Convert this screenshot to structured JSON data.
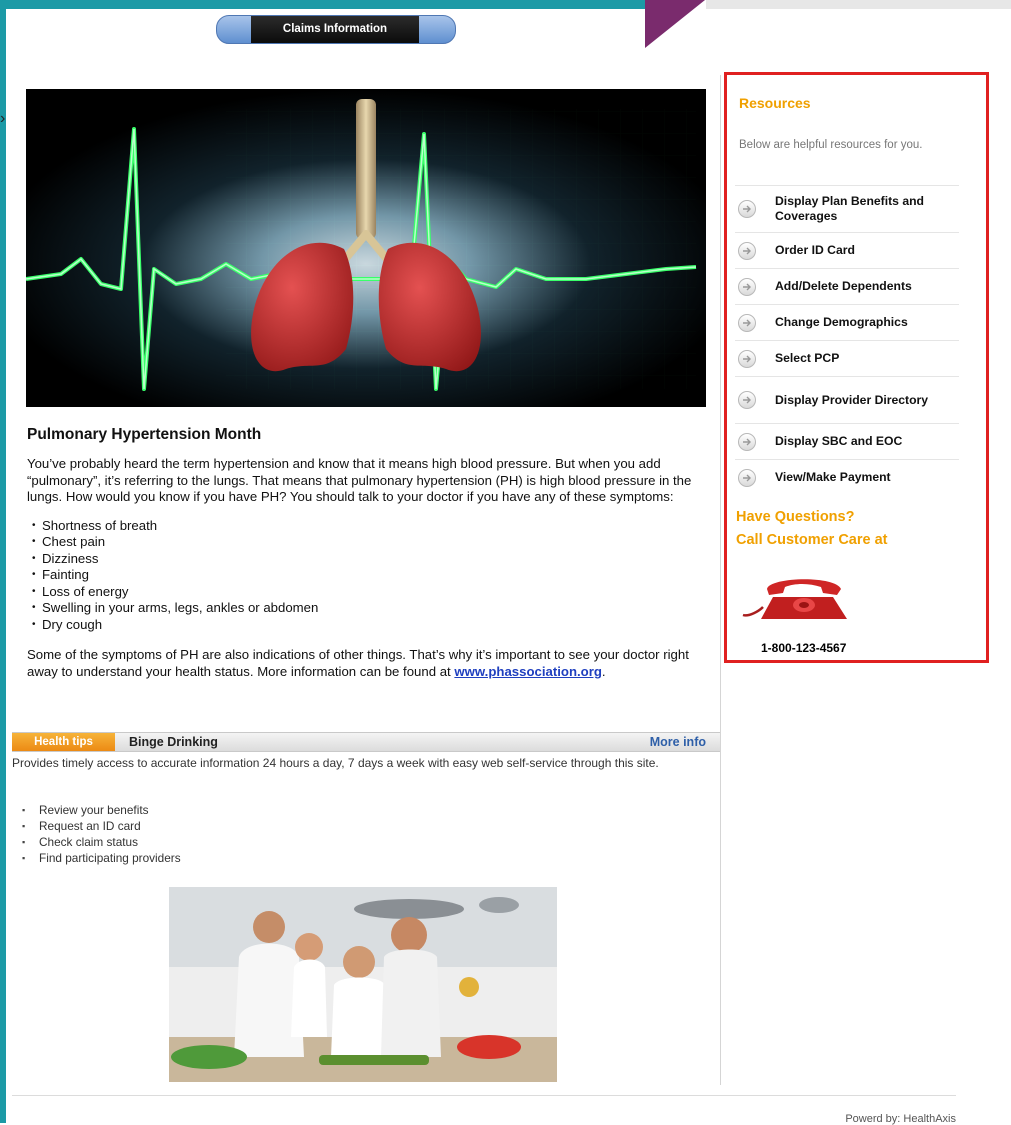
{
  "header": {
    "claims_button": "Claims Information"
  },
  "article": {
    "title": "Pulmonary Hypertension Month",
    "intro": "You’ve probably heard the term hypertension and know that it means high blood pressure.  But when you add “pulmonary”, it’s referring to the lungs.  That means that pulmonary hypertension (PH) is high blood pressure in the lungs.  How would you know if you have PH?  You should talk to your doctor if you have any of these symptoms:",
    "symptoms": [
      "Shortness of breath",
      "Chest pain",
      "Dizziness",
      "Fainting",
      "Loss of energy",
      "Swelling in your arms, legs, ankles or abdomen",
      "Dry cough"
    ],
    "closing_text": "Some of the symptoms of PH are also indications of other things.  That’s why it’s important to see your doctor right away to understand your health status. More information can be found at ",
    "link_text": "www.phassociation.org",
    "closing_end": "."
  },
  "health_tips": {
    "tab_label": "Health tips",
    "subject": "Binge Drinking",
    "more_info": "More info",
    "description": "Provides timely access to accurate information 24 hours a day, 7 days a week with easy web self-service through this site.",
    "items": [
      "Review your benefits",
      "Request an ID card",
      "Check claim status",
      "Find participating providers"
    ]
  },
  "resources": {
    "title": "Resources",
    "subtitle": "Below are helpful resources for you.",
    "items": [
      "Display Plan Benefits and Coverages",
      "Order ID Card",
      "Add/Delete Dependents",
      "Change Demographics",
      "Select PCP",
      "Display Provider Directory",
      "Display SBC and EOC",
      "View/Make Payment"
    ],
    "questions_line1": "Have Questions?",
    "questions_line2": "Call Customer Care at",
    "phone": "1-800-123-4567"
  },
  "footer": {
    "powered_by": "Powerd by: HealthAxis"
  },
  "colors": {
    "accent_orange": "#f0a000",
    "teal_frame": "#1c9aa6",
    "highlight_border": "#e02020",
    "link_blue": "#1f3fbf"
  },
  "icons": [
    "arrow-right-circle-icon",
    "telephone-icon"
  ]
}
